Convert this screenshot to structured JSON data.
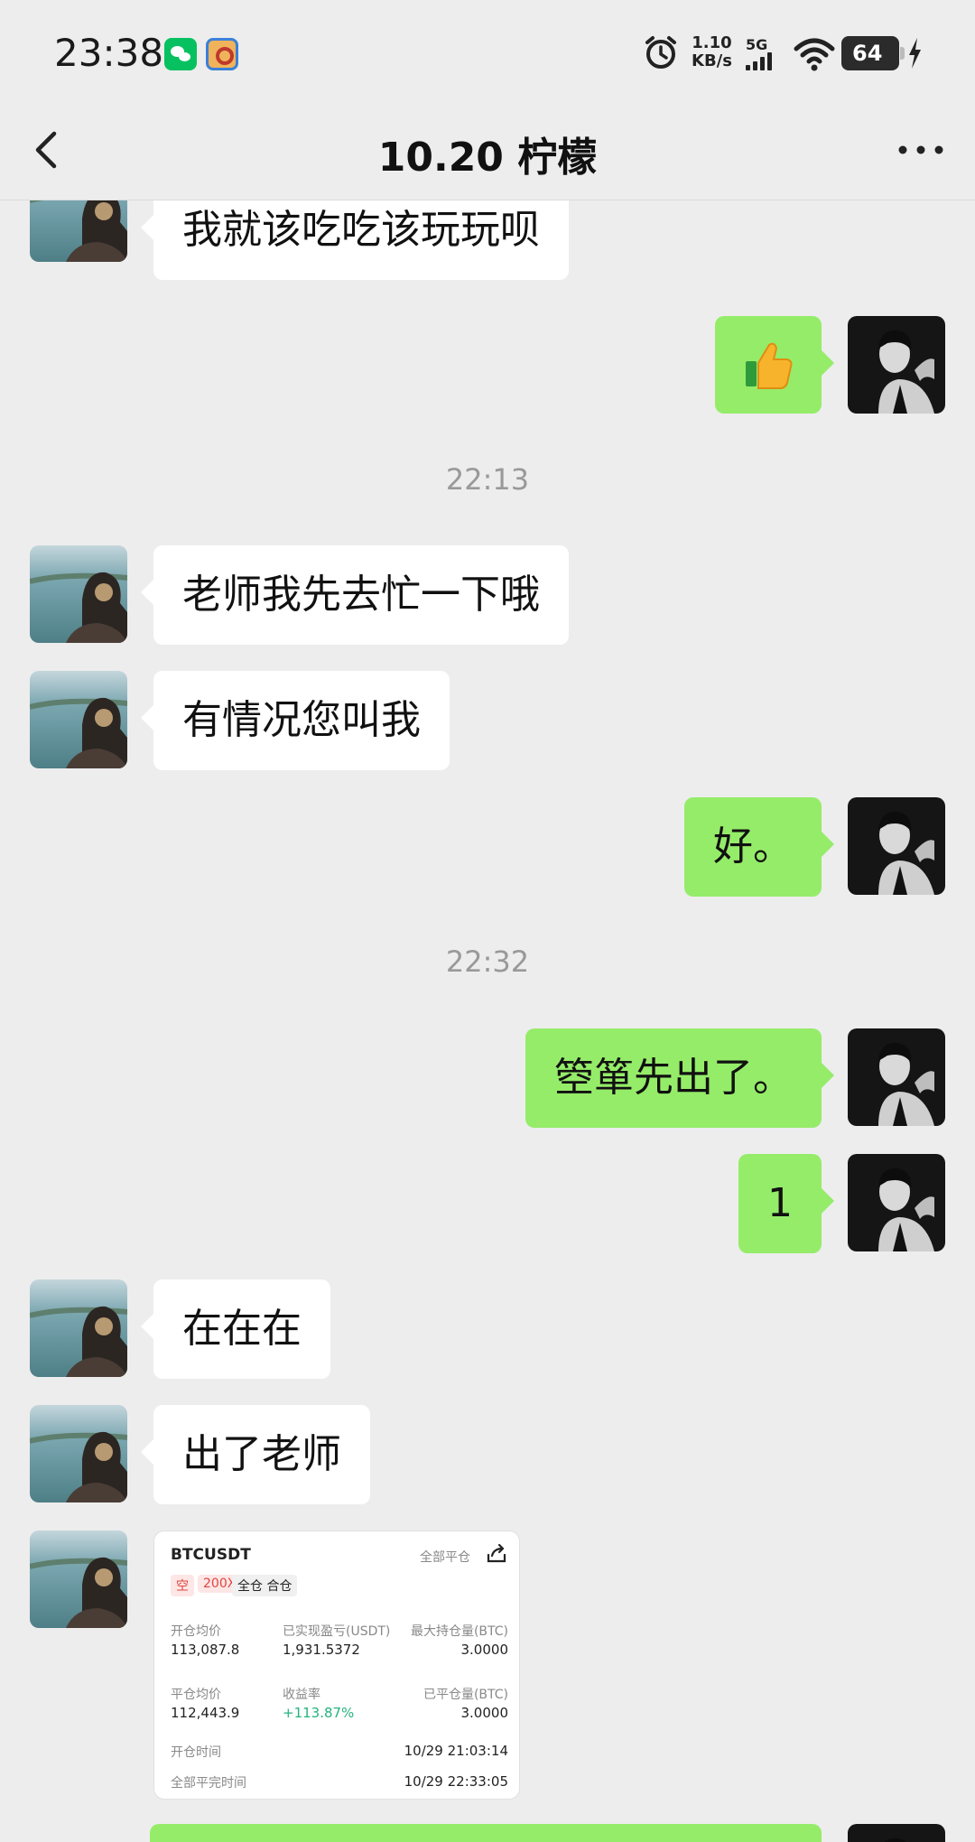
{
  "status_bar": {
    "time": "23:38",
    "net_speed_value": "1.10",
    "net_speed_unit": "KB/s",
    "network": "5G",
    "battery": "64",
    "icons": [
      "wechat-icon",
      "game-app-icon",
      "alarm-icon",
      "signal-icon",
      "wifi-icon",
      "battery-icon",
      "charging-icon"
    ]
  },
  "header": {
    "title": "10.20 柠檬"
  },
  "messages": [
    {
      "side": "left",
      "text": "我就该吃吃该玩玩呗"
    },
    {
      "side": "right",
      "text": "👍"
    },
    {
      "timestamp": "22:13"
    },
    {
      "side": "left",
      "text": "老师我先去忙一下哦"
    },
    {
      "side": "left",
      "text": "有情况您叫我"
    },
    {
      "side": "right",
      "text": "好。"
    },
    {
      "timestamp": "22:32"
    },
    {
      "side": "right",
      "text": "箜箪先出了。"
    },
    {
      "side": "right",
      "text": "1"
    },
    {
      "side": "left",
      "text": "在在在"
    },
    {
      "side": "left",
      "text": "出了老师"
    }
  ],
  "trade_card": {
    "symbol": "BTCUSDT",
    "close_all": "全部平仓",
    "direction": "空",
    "leverage": "200X",
    "margin_mode": "全仓 合仓",
    "open_avg_label": "开仓均价",
    "open_avg": "113,087.8",
    "realized_pnl_label": "已实现盈亏(USDT)",
    "realized_pnl": "1,931.5372",
    "max_pos_label": "最大持仓量(BTC)",
    "max_pos": "3.0000",
    "close_avg_label": "平仓均价",
    "close_avg": "112,443.9",
    "return_label": "收益率",
    "return_rate": "+113.87%",
    "closed_qty_label": "已平仓量(BTC)",
    "closed_qty": "3.0000",
    "open_time_label": "开仓时间",
    "open_time": "10/29 21:03:14",
    "close_time_label": "全部平完时间",
    "close_time": "10/29 22:33:05"
  },
  "colors": {
    "background": "#ededed",
    "bubble_self": "#95ec69",
    "bubble_other": "#ffffff",
    "profit_green": "#24b47e",
    "short_red": "#e0463f"
  }
}
